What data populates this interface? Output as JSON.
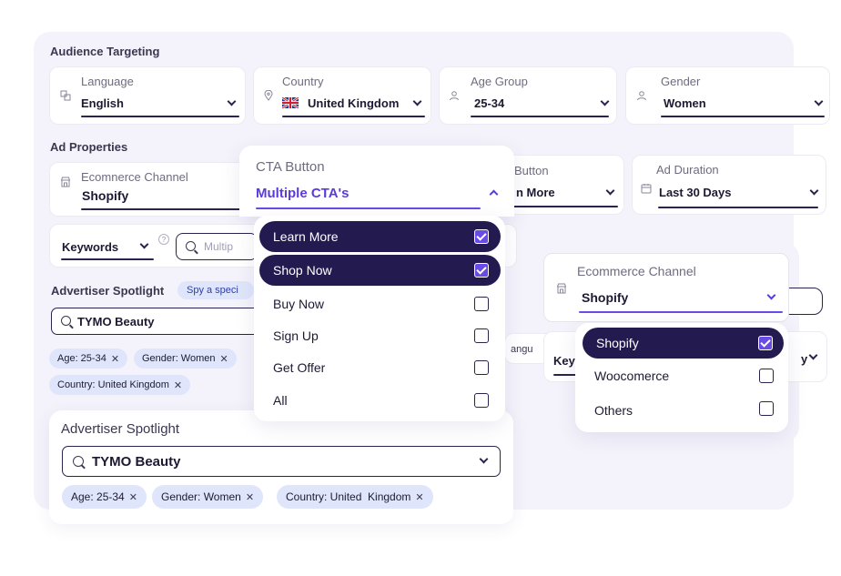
{
  "audience": {
    "title": "Audience Targeting",
    "language": {
      "label": "Language",
      "value": "English"
    },
    "country": {
      "label": "Country",
      "value": "United Kingdom"
    },
    "age": {
      "label": "Age Group",
      "value": "25-34"
    },
    "gender": {
      "label": "Gender",
      "value": "Women"
    }
  },
  "ad": {
    "title": "Ad Properties",
    "ecom": {
      "label": "Ecomnerce Channel",
      "value": "Shopify"
    },
    "cta_partial": {
      "label": "Button",
      "value": "n More"
    },
    "duration": {
      "label": "Ad Duration",
      "value": "Last 30 Days"
    }
  },
  "keywords": {
    "label": "Keywords",
    "help": "?",
    "placeholder": "Multip"
  },
  "spotlight_small": {
    "title": "Advertiser Spotlight",
    "badge": "Spy a speci",
    "search_value": "TYMO Beauty",
    "chips": [
      "Age: 25-34",
      "Gender: Women",
      "Country: United Kingdom"
    ]
  },
  "cta_dropdown": {
    "label": "CTA Button",
    "value": "Multiple CTA's",
    "options": [
      {
        "label": "Learn More",
        "checked": true
      },
      {
        "label": "Shop Now",
        "checked": true
      },
      {
        "label": "Buy Now",
        "checked": false
      },
      {
        "label": "Sign Up",
        "checked": false
      },
      {
        "label": "Get Offer",
        "checked": false
      },
      {
        "label": "All",
        "checked": false
      }
    ]
  },
  "ecom_dropdown": {
    "label": "Ecommerce Channel",
    "value": "Shopify",
    "options": [
      {
        "label": "Shopify",
        "checked": true
      },
      {
        "label": "Woocomerce",
        "checked": false
      },
      {
        "label": "Others",
        "checked": false
      }
    ]
  },
  "behind_right": {
    "language_partial": "angu",
    "keywords_partial": "Key",
    "other_partial": "y"
  },
  "spotlight_large": {
    "title": "Advertiser Spotlight",
    "search_value": "TYMO Beauty",
    "chips": [
      "Age: 25-34",
      "Gender: Women",
      "Country: United  Kingdom"
    ]
  },
  "colors": {
    "accent": "#5b3bd9",
    "selected_bg": "#231a4f",
    "chip_bg": "#dfe6fb",
    "panel_bg": "#f4f3fb"
  }
}
